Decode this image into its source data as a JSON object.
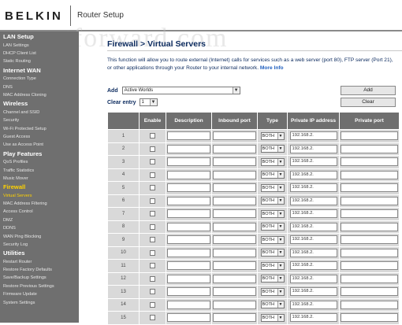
{
  "header": {
    "logo": "BELKIN",
    "app_title": "Router Setup",
    "watermark": "portforward.com"
  },
  "sidebar": {
    "items": [
      {
        "label": "LAN Setup",
        "type": "heading"
      },
      {
        "label": "LAN Settings",
        "type": "item"
      },
      {
        "label": "DHCP Client List",
        "type": "item"
      },
      {
        "label": "Static Routing",
        "type": "item"
      },
      {
        "label": "Internet WAN",
        "type": "heading"
      },
      {
        "label": "Connection Type",
        "type": "item"
      },
      {
        "label": "DNS",
        "type": "item"
      },
      {
        "label": "MAC Address Cloning",
        "type": "item"
      },
      {
        "label": "Wireless",
        "type": "heading"
      },
      {
        "label": "Channel and SSID",
        "type": "item"
      },
      {
        "label": "Security",
        "type": "item"
      },
      {
        "label": "Wi-Fi Protected Setup",
        "type": "item"
      },
      {
        "label": "Guest Access",
        "type": "item"
      },
      {
        "label": "Use as Access Point",
        "type": "item"
      },
      {
        "label": "Play Features",
        "type": "heading"
      },
      {
        "label": "QoS Profiles",
        "type": "item"
      },
      {
        "label": "Traffic Statistics",
        "type": "item"
      },
      {
        "label": "Music Mover",
        "type": "item"
      },
      {
        "label": "Firewall",
        "type": "heading-accent"
      },
      {
        "label": "Virtual Servers",
        "type": "active"
      },
      {
        "label": "MAC Address Filtering",
        "type": "item"
      },
      {
        "label": "Access Control",
        "type": "item"
      },
      {
        "label": "DMZ",
        "type": "item"
      },
      {
        "label": "DDNS",
        "type": "item"
      },
      {
        "label": "WAN Ping Blocking",
        "type": "item"
      },
      {
        "label": "Security Log",
        "type": "item"
      },
      {
        "label": "Utilities",
        "type": "heading"
      },
      {
        "label": "Restart Router",
        "type": "item"
      },
      {
        "label": "Restore Factory Defaults",
        "type": "item"
      },
      {
        "label": "Save/Backup Settings",
        "type": "item"
      },
      {
        "label": "Restore Previous Settings",
        "type": "item"
      },
      {
        "label": "Firmware Update",
        "type": "item"
      },
      {
        "label": "System Settings",
        "type": "item"
      }
    ]
  },
  "main": {
    "title": "Firewall > Virtual Servers",
    "intro": "This function will allow you to route external (Internet) calls for services such as a web server (port 80), FTP server (Port 21), or other applications through your Router to your internal network.",
    "more_info": "More Info",
    "add_label": "Add",
    "add_selected": "Active Worlds",
    "clear_label": "Clear entry",
    "clear_selected": "1",
    "add_button": "Add",
    "clear_button": "Clear",
    "columns": [
      "",
      "Enable",
      "Description",
      "Inbound port",
      "Type",
      "Private IP address",
      "Private port"
    ],
    "rows": [
      {
        "num": "1",
        "type": "BOTH",
        "ip": "192.168.2."
      },
      {
        "num": "2",
        "type": "BOTH",
        "ip": "192.168.2."
      },
      {
        "num": "3",
        "type": "BOTH",
        "ip": "192.168.2."
      },
      {
        "num": "4",
        "type": "BOTH",
        "ip": "192.168.2."
      },
      {
        "num": "5",
        "type": "BOTH",
        "ip": "192.168.2."
      },
      {
        "num": "6",
        "type": "BOTH",
        "ip": "192.168.2."
      },
      {
        "num": "7",
        "type": "BOTH",
        "ip": "192.168.2."
      },
      {
        "num": "8",
        "type": "BOTH",
        "ip": "192.168.2."
      },
      {
        "num": "9",
        "type": "BOTH",
        "ip": "192.168.2."
      },
      {
        "num": "10",
        "type": "BOTH",
        "ip": "192.168.2."
      },
      {
        "num": "11",
        "type": "BOTH",
        "ip": "192.168.2."
      },
      {
        "num": "12",
        "type": "BOTH",
        "ip": "192.168.2."
      },
      {
        "num": "13",
        "type": "BOTH",
        "ip": "192.168.2."
      },
      {
        "num": "14",
        "type": "BOTH",
        "ip": "192.168.2."
      },
      {
        "num": "15",
        "type": "BOTH",
        "ip": "192.168.2."
      }
    ]
  }
}
